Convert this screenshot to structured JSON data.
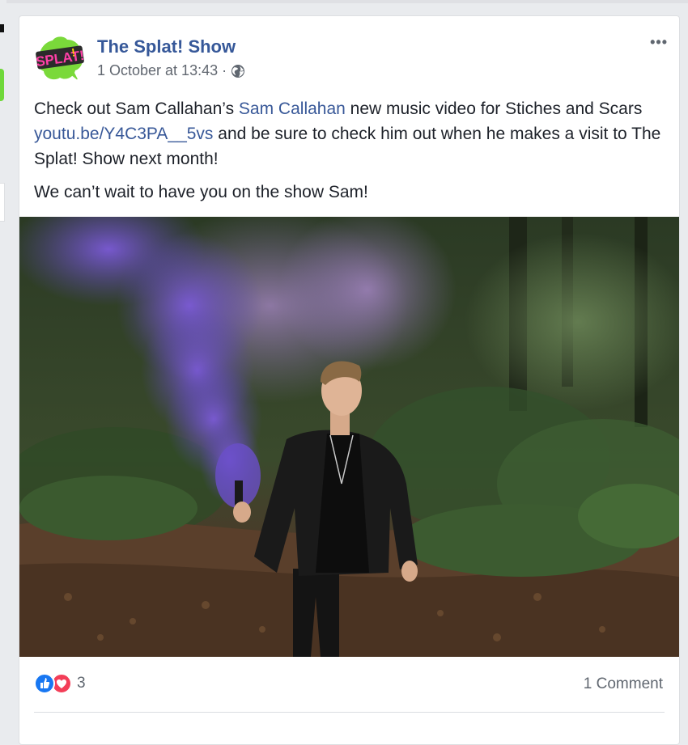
{
  "post": {
    "page_name": "The Splat! Show",
    "timestamp": "1 October at 13:43",
    "separator": "·",
    "privacy_icon": "globe-icon",
    "more_label": "•••",
    "avatar_text": "SPLAT!",
    "text": {
      "p1_part1": "Check out Sam Callahan’s ",
      "p1_mention": "Sam Callahan",
      "p1_part2": " new music video for Stiches and Scars ",
      "p1_link": "youtu.be/Y4C3PA__5vs",
      "p1_part3": " and be sure to check him out when he makes a visit to The Splat! Show next month!",
      "p2": "We can’t wait to have you on the show Sam!"
    },
    "photo": {
      "description_icon": "photo-man-purple-smoke-forest"
    }
  },
  "footer": {
    "reaction_icons": [
      "like-icon",
      "love-icon"
    ],
    "reaction_count": "3",
    "comments_label": "1 Comment"
  },
  "colors": {
    "link": "#385898",
    "page_name": "#365899",
    "background": "#e9ebee",
    "like": "#1877f2",
    "love": "#f33e58"
  }
}
